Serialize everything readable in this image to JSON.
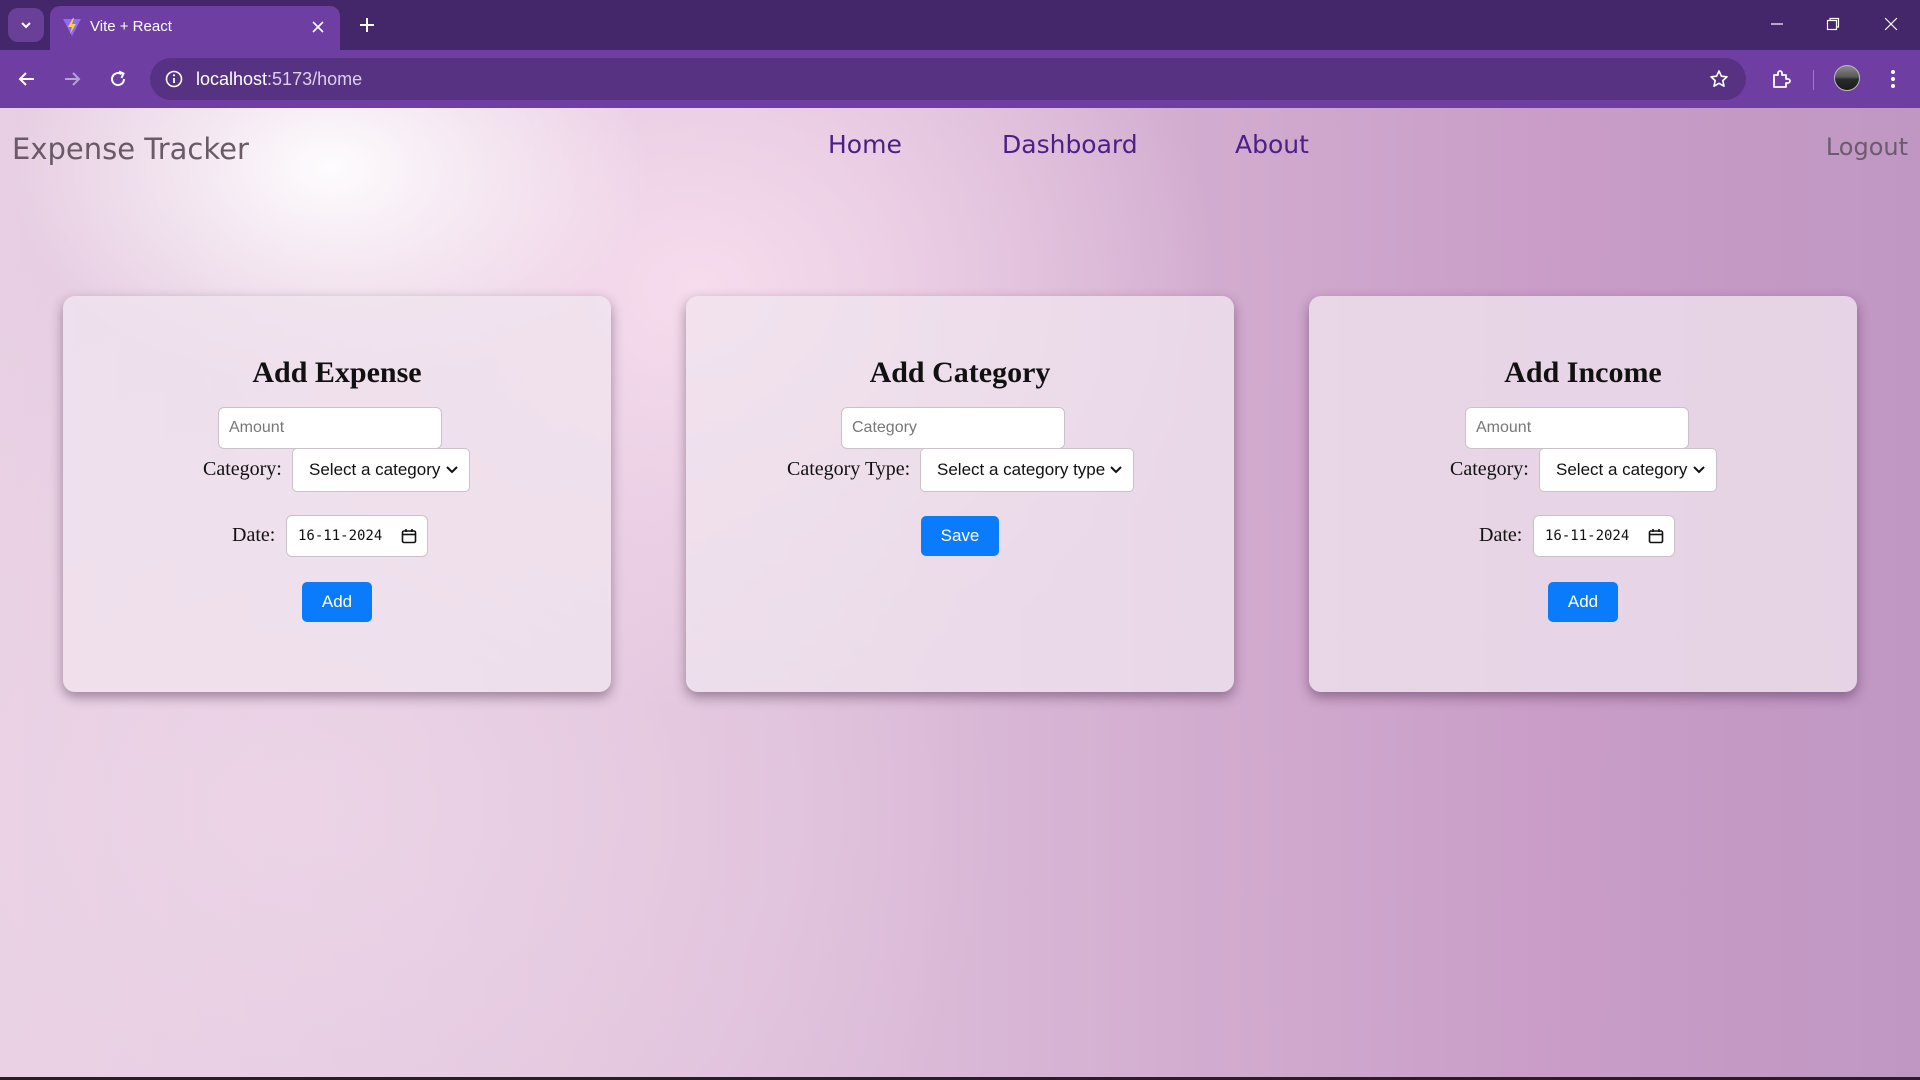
{
  "browser": {
    "tab_title": "Vite + React",
    "url_host": "localhost",
    "url_path": ":5173/home"
  },
  "navbar": {
    "brand": "Expense Tracker",
    "links": [
      "Home",
      "Dashboard",
      "About"
    ],
    "logout": "Logout"
  },
  "cards": {
    "expense": {
      "title": "Add Expense",
      "amount_placeholder": "Amount",
      "category_label": "Category:",
      "category_value": "Select a category",
      "date_label": "Date:",
      "date_value": "16-11-2024",
      "button": "Add"
    },
    "category": {
      "title": "Add Category",
      "category_placeholder": "Category",
      "type_label": "Category Type:",
      "type_value": "Select a category type",
      "button": "Save"
    },
    "income": {
      "title": "Add Income",
      "amount_placeholder": "Amount",
      "category_label": "Category:",
      "category_value": "Select a category",
      "date_label": "Date:",
      "date_value": "16-11-2024",
      "button": "Add"
    }
  },
  "colors": {
    "browser_frame": "#44276a",
    "toolbar": "#6e3ea2",
    "nav_link": "#4b1f86",
    "primary_button": "#0a7cfb"
  }
}
